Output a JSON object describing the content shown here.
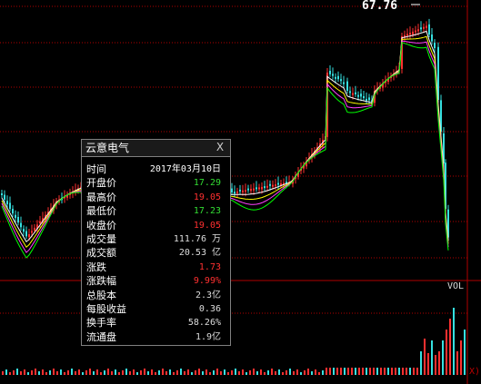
{
  "chart": {
    "peak_label": "67.76",
    "volume_label": "VOL",
    "axis_mark": "X)",
    "colors": {
      "up": "#ff3030",
      "down": "#36e0e0",
      "ma5": "#ffffff",
      "ma10": "#ffff00",
      "ma20": "#ff40ff",
      "ma30": "#00ff00",
      "grid": "#b00000"
    }
  },
  "popup": {
    "title": "云意电气",
    "close_glyph": "X",
    "rows": [
      {
        "label": "时间",
        "value": "2017年03月10日",
        "color": "#ffffff"
      },
      {
        "label": "开盘价",
        "value": "17.29",
        "color": "#33dd33"
      },
      {
        "label": "最高价",
        "value": "19.05",
        "color": "#ff3030"
      },
      {
        "label": "最低价",
        "value": "17.23",
        "color": "#33dd33"
      },
      {
        "label": "收盘价",
        "value": "19.05",
        "color": "#ff3030"
      },
      {
        "label": "成交量",
        "value": "111.76 万",
        "color": "#dddddd"
      },
      {
        "label": "成交额",
        "value": "20.53 亿",
        "color": "#dddddd"
      },
      {
        "label": "涨跌",
        "value": "1.73",
        "color": "#ff3030"
      },
      {
        "label": "涨跌幅",
        "value": "9.99%",
        "color": "#ff3030"
      },
      {
        "label": "总股本",
        "value": "2.3亿",
        "color": "#dddddd"
      },
      {
        "label": "每股收益",
        "value": "0.36",
        "color": "#dddddd"
      },
      {
        "label": "换手率",
        "value": "58.26%",
        "color": "#dddddd"
      },
      {
        "label": "流通盘",
        "value": "1.9亿",
        "color": "#dddddd"
      }
    ]
  }
}
